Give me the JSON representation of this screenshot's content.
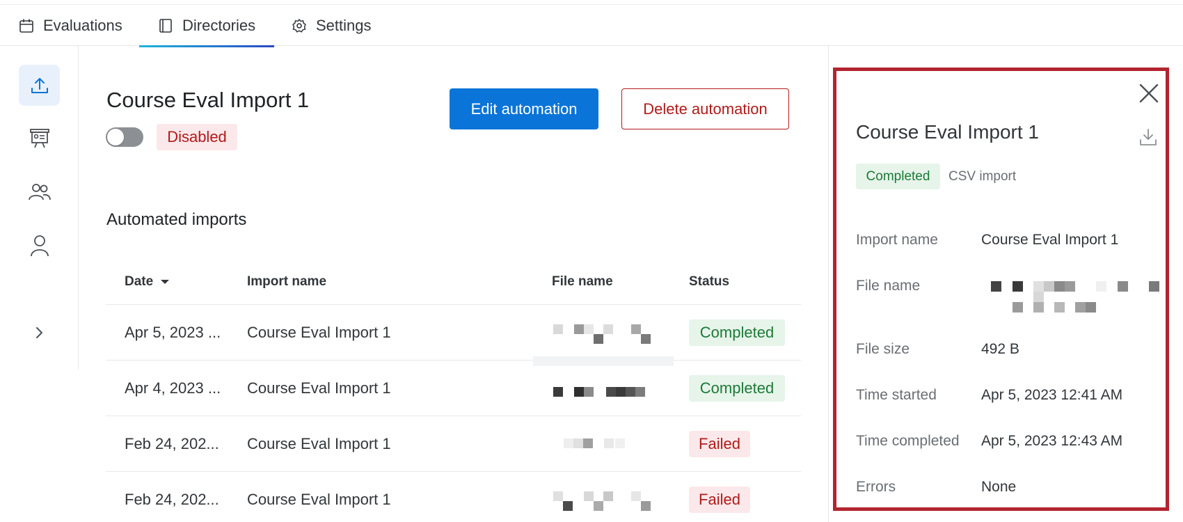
{
  "nav": {
    "tabs": [
      {
        "label": "Evaluations",
        "icon": "calendar-icon"
      },
      {
        "label": "Directories",
        "icon": "directory-book-icon",
        "active": true
      },
      {
        "label": "Settings",
        "icon": "gear-icon"
      }
    ]
  },
  "rail": {
    "items": [
      {
        "icon": "upload-icon",
        "active": true
      },
      {
        "icon": "presentation-icon"
      },
      {
        "icon": "users-icon"
      },
      {
        "icon": "user-icon"
      },
      {
        "icon": "chevron-right-icon"
      }
    ]
  },
  "main": {
    "title": "Course Eval Import 1",
    "status_badge": "Disabled",
    "edit_button": "Edit automation",
    "delete_button": "Delete automation",
    "section_title": "Automated imports"
  },
  "table": {
    "headers": {
      "date": "Date",
      "import_name": "Import name",
      "file_name": "File name",
      "status": "Status"
    },
    "rows": [
      {
        "date": "Apr 5, 2023 ...",
        "import_name": "Course Eval Import 1",
        "status": "Completed"
      },
      {
        "date": "Apr 4, 2023 ...",
        "import_name": "Course Eval Import 1",
        "status": "Completed"
      },
      {
        "date": "Feb 24, 202...",
        "import_name": "Course Eval Import 1",
        "status": "Failed"
      },
      {
        "date": "Feb 24, 202...",
        "import_name": "Course Eval Import 1",
        "status": "Failed"
      }
    ]
  },
  "panel": {
    "title": "Course Eval Import 1",
    "status": "Completed",
    "type": "CSV import",
    "fields": [
      {
        "label": "Import name",
        "value": "Course Eval Import 1"
      },
      {
        "label": "File name",
        "value": ""
      },
      {
        "label": "File size",
        "value": "492 B"
      },
      {
        "label": "Time started",
        "value": "Apr 5, 2023 12:41 AM"
      },
      {
        "label": "Time completed",
        "value": "Apr 5, 2023 12:43 AM"
      },
      {
        "label": "Errors",
        "value": "None"
      }
    ]
  },
  "colors": {
    "primary": "#0b74d8",
    "danger": "#b11a1a",
    "success": "#1d7a36",
    "highlight_border": "#b3242f"
  }
}
